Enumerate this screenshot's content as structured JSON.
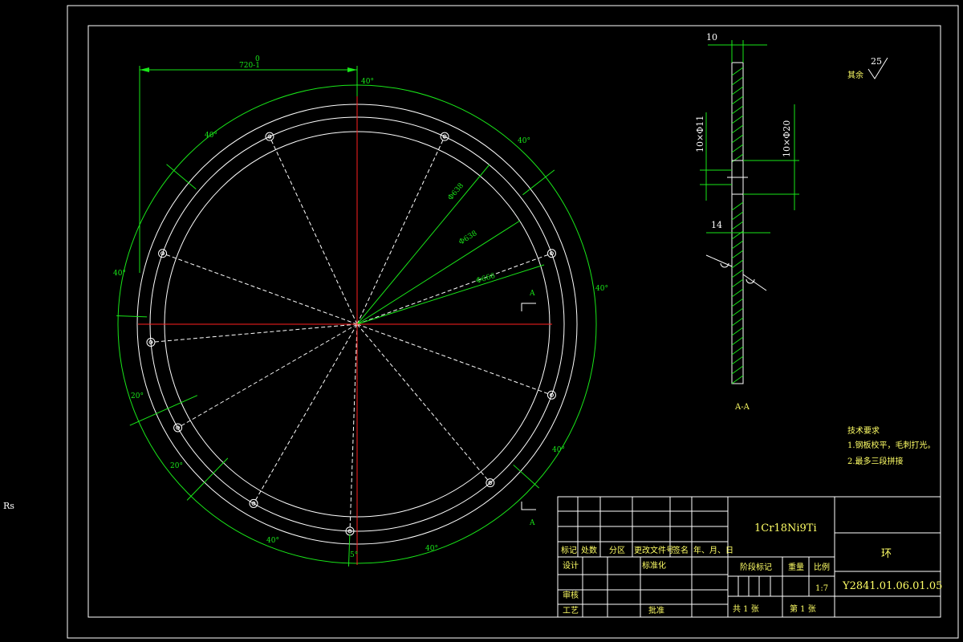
{
  "colors": {
    "background": "#000000",
    "frame": "#ffffff",
    "dimension": "#19e619",
    "centerline": "#ff2020",
    "text": "#ffff66"
  },
  "side_label": "Rs",
  "front_view": {
    "top_dimension": "720-1",
    "top_dim_sup": "0",
    "angle_labels": [
      "40°",
      "40°",
      "40°",
      "40°",
      "40°",
      "20°",
      "20°",
      "40°",
      "40°",
      "40°"
    ],
    "bottom_small": "5°",
    "radial_labels": [
      "Φ638",
      "Φ638",
      "Φ666"
    ],
    "section_marker": "A"
  },
  "section_view": {
    "top_dim": "10",
    "left_dim": "10×Φ11",
    "right_dim": "10×Φ20",
    "mid_dim": "14",
    "label": "A-A"
  },
  "roughness": {
    "label": "其余",
    "value": "25"
  },
  "tech_requirements": {
    "title": "技术要求",
    "items": [
      "1.钢板校平，毛刺打光。",
      "2.最多三段拼接"
    ]
  },
  "title_block": {
    "revision_headers": [
      "标记",
      "处数",
      "分区",
      "更改文件号",
      "签名",
      "年、月、日"
    ],
    "design": "设计",
    "standardization": "标准化",
    "review": "审核",
    "process": "工艺",
    "approve": "批准",
    "material": "1Cr18Ni9Ti",
    "stage_mark": "阶段标记",
    "weight": "重量",
    "scale_label": "比例",
    "scale": "1:7",
    "sheets_total": "共  1  张",
    "sheet_no": "第  1  张",
    "part_name": "环",
    "drawing_no": "Y2841.01.06.01.05"
  }
}
